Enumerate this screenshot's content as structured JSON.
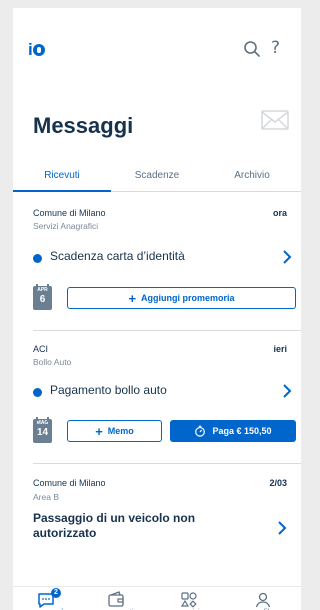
{
  "header": {
    "logo_text": "io",
    "help_symbol": "?",
    "icons": [
      "search-icon",
      "help-icon"
    ]
  },
  "page": {
    "title": "Messaggi",
    "title_icon": "envelope-icon"
  },
  "tabs": [
    {
      "label": "Ricevuti",
      "active": true
    },
    {
      "label": "Scadenze",
      "active": false
    },
    {
      "label": "Archivio",
      "active": false
    }
  ],
  "messages": [
    {
      "sender": "Comune di Milano",
      "service": "Servizi Anagrafici",
      "time": "ora",
      "subject": "Scadenza carta d’identità",
      "unread": true,
      "calendar": {
        "month": "APR",
        "day": "6"
      },
      "actions": [
        {
          "label": "Aggiungi promemoria",
          "icon": "plus-icon"
        }
      ]
    },
    {
      "sender": "ACI",
      "service": "Bollo Auto",
      "time": "ieri",
      "subject": "Pagamento bollo auto",
      "unread": true,
      "calendar": {
        "month": "MAG",
        "day": "14"
      },
      "actions": [
        {
          "label": "Memo",
          "icon": "plus-icon"
        },
        {
          "label": "Paga € 150,50",
          "icon": "timer-icon"
        }
      ]
    },
    {
      "sender": "Comune di Milano",
      "service": "Area B",
      "time": "2/03",
      "subject": "Passaggio di un veicolo non autorizzato",
      "unread": false
    }
  ],
  "bottom_nav": [
    {
      "label": "messaggi",
      "icon": "message-icon",
      "active": true,
      "badge": "2"
    },
    {
      "label": "pagamenti",
      "icon": "wallet-icon",
      "active": false
    },
    {
      "label": "servizi",
      "icon": "services-icon",
      "active": false
    },
    {
      "label": "profilo",
      "icon": "profile-icon",
      "active": false
    }
  ],
  "colors": {
    "accent": "#0066cc",
    "text": "#17324d",
    "muted": "#5c6f82",
    "background": "#ececec"
  }
}
